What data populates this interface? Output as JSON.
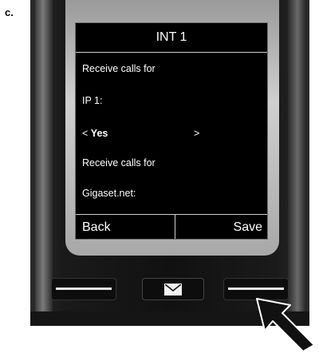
{
  "figure": {
    "label": "c."
  },
  "screen": {
    "title": "INT 1",
    "lines": [
      "Receive calls for",
      "IP 1:",
      "Receive calls for",
      "Gigaset.net:"
    ],
    "selector": {
      "left_arrow": "<",
      "value": "Yes",
      "right_arrow": ">"
    },
    "softkeys": {
      "left": "Back",
      "right": "Save"
    }
  },
  "keys": {
    "message_icon": "envelope-icon"
  },
  "pointer": {
    "icon": "arrow-pointer-icon"
  }
}
